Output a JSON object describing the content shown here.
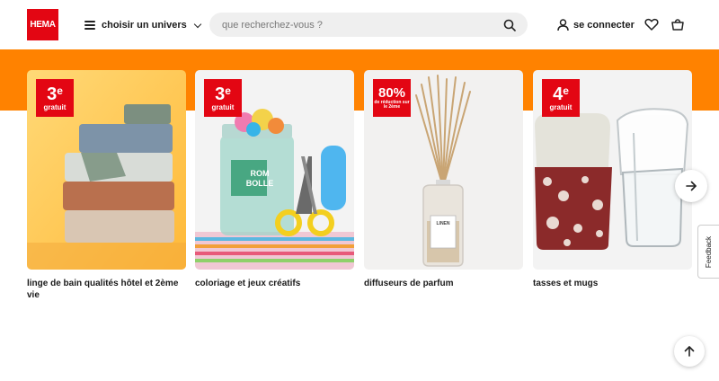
{
  "header": {
    "logo_text": "HEMA",
    "menu_label": "choisir un univers",
    "search_placeholder": "que recherchez-vous ?",
    "account_label": "se connecter"
  },
  "colors": {
    "brand": "#e30613",
    "band": "#ff8200"
  },
  "cards": [
    {
      "badge_big": "3",
      "badge_sup": "e",
      "badge_small": "gratuit",
      "caption": "linge de bain qualités hôtel et 2ème vie"
    },
    {
      "badge_big": "3",
      "badge_sup": "e",
      "badge_small": "gratuit",
      "caption": "coloriage et jeux créatifs"
    },
    {
      "badge_big": "80%",
      "badge_tiny": "de réduction sur le 2ème",
      "caption": "diffuseurs de parfum",
      "product_label": "LINEN"
    },
    {
      "badge_big": "4",
      "badge_sup": "e",
      "badge_small": "gratuit",
      "caption": "tasses et mugs"
    }
  ],
  "jar_label": "ROM BOLLE",
  "feedback_label": "Feedback"
}
